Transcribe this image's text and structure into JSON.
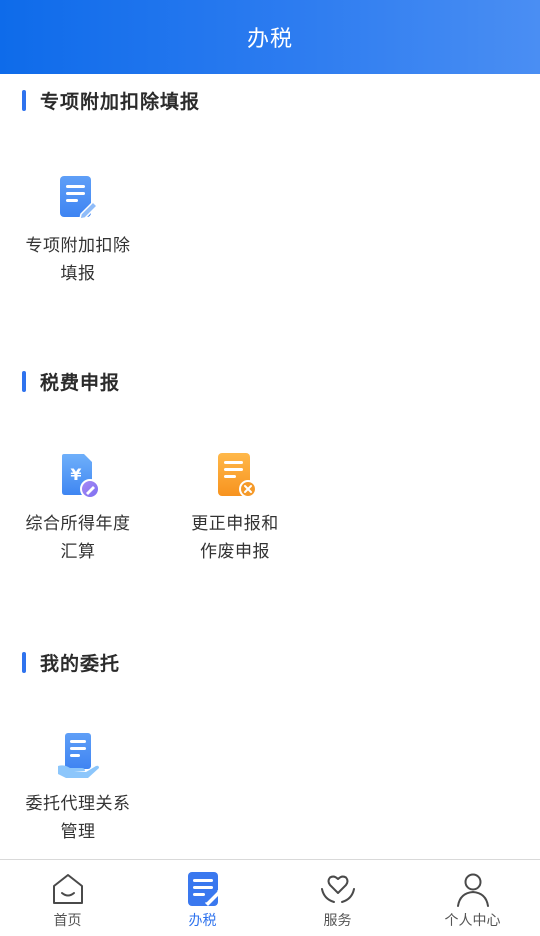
{
  "header": {
    "title": "办税"
  },
  "sections": [
    {
      "title": "专项附加扣除填报"
    },
    {
      "title": "税费申报"
    },
    {
      "title": "我的委托"
    }
  ],
  "tiles": {
    "special_deduction": {
      "line1": "专项附加扣除",
      "line2": "填报",
      "icon": "form-edit-icon"
    },
    "annual_settlement": {
      "line1": "综合所得年度",
      "line2": "汇算",
      "icon": "yuan-document-icon"
    },
    "correct_void": {
      "line1": "更正申报和",
      "line2": "作废申报",
      "icon": "document-cancel-icon"
    },
    "delegation": {
      "line1": "委托代理关系",
      "line2": "管理",
      "icon": "hand-document-icon"
    }
  },
  "tabbar": {
    "items": [
      {
        "label": "首页",
        "icon": "home-icon",
        "active": false
      },
      {
        "label": "办税",
        "icon": "tax-form-icon",
        "active": true
      },
      {
        "label": "服务",
        "icon": "heart-hands-icon",
        "active": false
      },
      {
        "label": "个人中心",
        "icon": "user-icon",
        "active": false
      }
    ]
  },
  "colors": {
    "accent": "#2f73ee",
    "header_start": "#0e6bea",
    "header_end": "#4a8ef3",
    "orange": "#f7a128"
  }
}
